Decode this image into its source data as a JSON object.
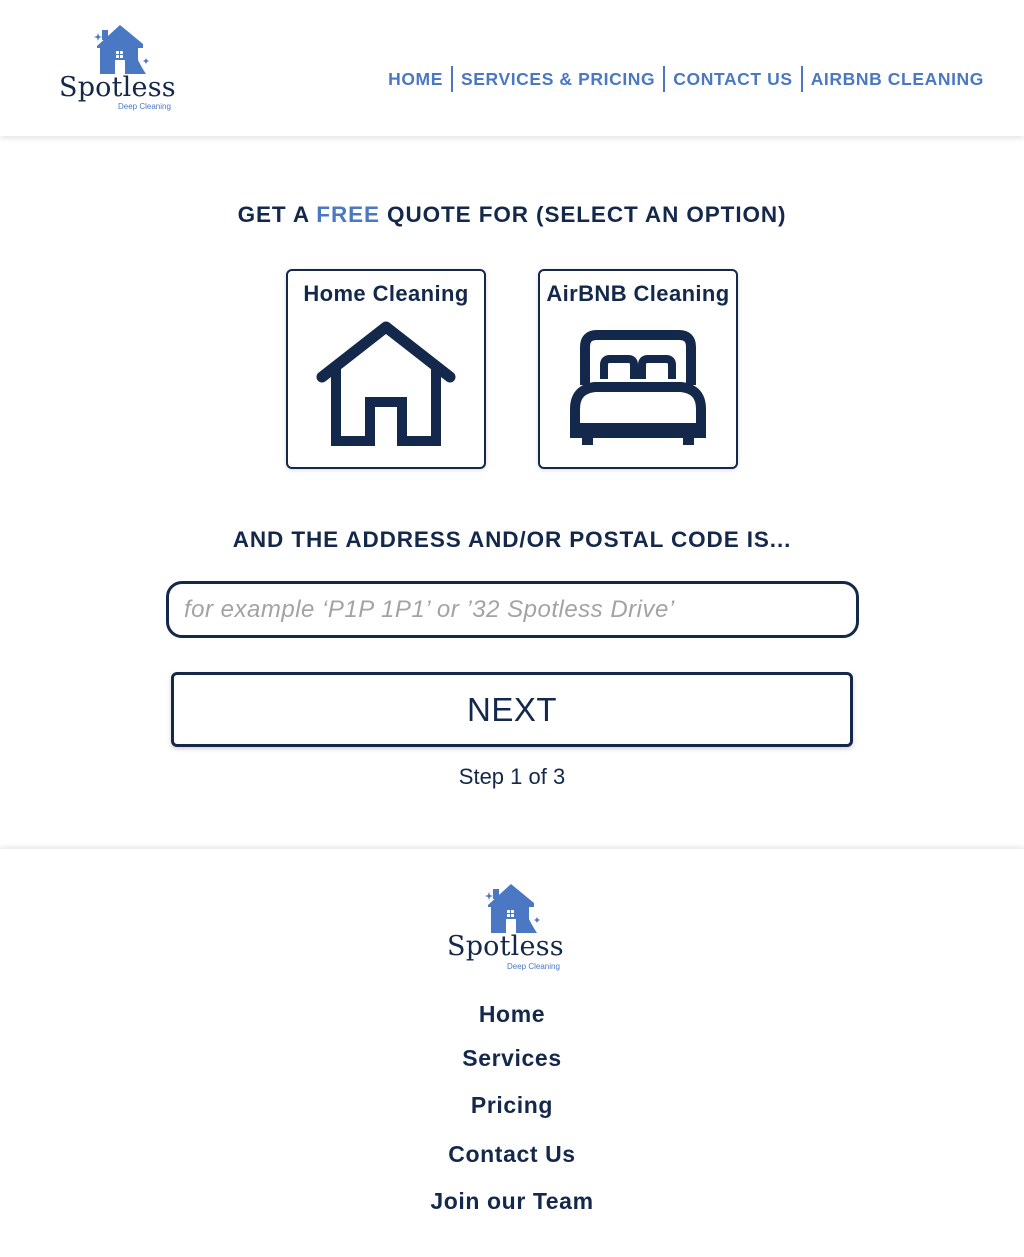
{
  "brand": {
    "name": "Spotless",
    "tagline": "Deep Cleaning",
    "colors": {
      "navy": "#14284b",
      "accent_blue": "#4a78c2",
      "placeholder_gray": "#a3a3a3"
    },
    "logo_icon": "house-sparkle-icon"
  },
  "nav": {
    "items": [
      {
        "label": "HOME"
      },
      {
        "label": "SERVICES & PRICING"
      },
      {
        "label": "CONTACT US"
      },
      {
        "label": "AIRBNB CLEANING"
      }
    ]
  },
  "quote": {
    "heading_pre": "GET A ",
    "heading_accent": "FREE",
    "heading_post": " QUOTE FOR (SELECT AN OPTION)",
    "options": [
      {
        "label": "Home Cleaning",
        "icon": "house-outline-icon"
      },
      {
        "label": "AirBNB Cleaning",
        "icon": "bed-icon"
      }
    ],
    "address_heading": "AND THE ADDRESS AND/OR POSTAL CODE IS...",
    "address_placeholder": "for example ‘P1P 1P1’ or ’32 Spotless Drive’",
    "address_value": "",
    "next_label": "NEXT",
    "step_text": "Step 1 of 3"
  },
  "footer": {
    "links": [
      {
        "label": "Home"
      },
      {
        "label": "Services"
      },
      {
        "label": "Pricing"
      },
      {
        "label": "Contact Us"
      },
      {
        "label": "Join our Team"
      }
    ]
  }
}
